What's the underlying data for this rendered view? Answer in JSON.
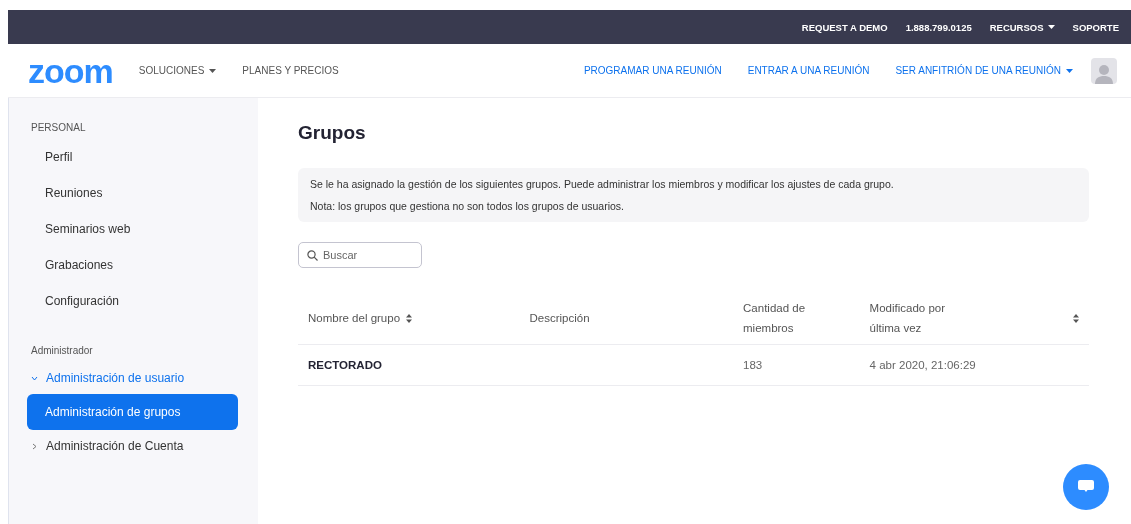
{
  "top_bar": {
    "links": [
      {
        "label": "REQUEST A DEMO",
        "dropdown": false
      },
      {
        "label": "1.888.799.0125",
        "dropdown": false
      },
      {
        "label": "RECURSOS",
        "dropdown": true
      },
      {
        "label": "SOPORTE",
        "dropdown": false
      }
    ]
  },
  "nav": {
    "logo": "zoom",
    "left_links": [
      {
        "label": "SOLUCIONES",
        "dropdown": true
      },
      {
        "label": "PLANES Y PRECIOS",
        "dropdown": false
      }
    ],
    "right_links": [
      {
        "label": "PROGRAMAR UNA REUNIÓN",
        "dropdown": false
      },
      {
        "label": "ENTRAR A UNA REUNIÓN",
        "dropdown": false
      },
      {
        "label": "SER ANFITRIÓN DE UNA REUNIÓN",
        "dropdown": true
      }
    ]
  },
  "sidebar": {
    "sections": [
      {
        "title": "PERSONAL",
        "items": [
          {
            "kind": "link",
            "label": "Perfil",
            "selected": false
          },
          {
            "kind": "link",
            "label": "Reuniones",
            "selected": false
          },
          {
            "kind": "link",
            "label": "Seminarios web",
            "selected": false
          },
          {
            "kind": "link",
            "label": "Grabaciones",
            "selected": false
          },
          {
            "kind": "link",
            "label": "Configuración",
            "selected": false
          }
        ]
      },
      {
        "title": "Administrador",
        "items": [
          {
            "kind": "group",
            "label": "Administración de usuario",
            "expanded": true,
            "children": [
              {
                "kind": "link",
                "label": "Administración de grupos",
                "selected": true
              }
            ]
          },
          {
            "kind": "group",
            "label": "Administración de Cuenta",
            "expanded": false
          }
        ]
      }
    ]
  },
  "main": {
    "title": "Grupos",
    "notice": [
      "Se le ha asignado la gestión de los siguientes grupos. Puede administrar los miembros y modificar los ajustes de cada grupo.",
      "Nota: los grupos que gestiona no son todos los grupos de usuarios."
    ],
    "search": {
      "placeholder": "Buscar"
    },
    "table": {
      "columns": [
        {
          "lines": [
            "Nombre del grupo"
          ],
          "sortable": true
        },
        {
          "lines": [
            "Descripción"
          ],
          "sortable": false
        },
        {
          "lines": [
            "Cantidad de",
            "miembros"
          ],
          "sortable": false
        },
        {
          "lines": [
            "Modificado por",
            "última vez"
          ],
          "sortable": true
        }
      ],
      "rows": [
        [
          "RECTORADO",
          "",
          "183",
          "4 abr 2020, 21:06:29"
        ]
      ]
    }
  }
}
